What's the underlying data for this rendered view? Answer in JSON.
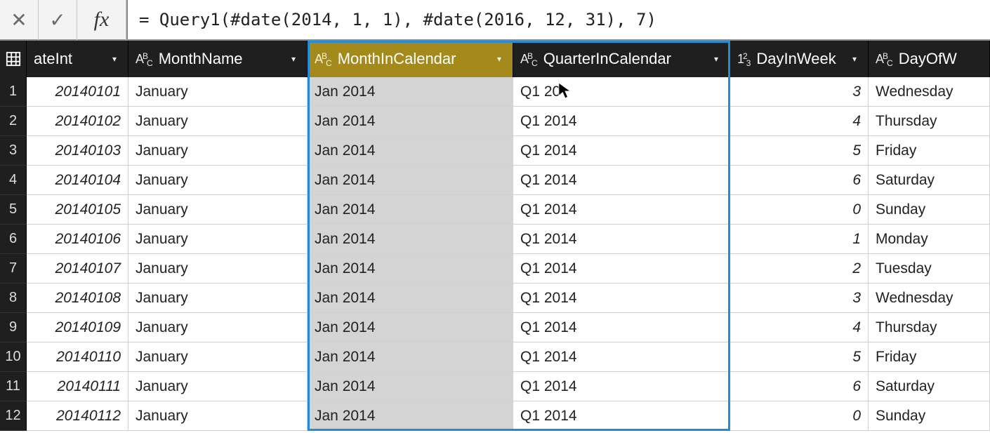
{
  "formula_bar": {
    "cancel_glyph": "✕",
    "confirm_glyph": "✓",
    "fx_label": "fx",
    "formula": "= Query1(#date(2014, 1, 1), #date(2016, 12, 31), 7)"
  },
  "columns": {
    "dateint": {
      "label": "ateInt",
      "type": "num"
    },
    "monthname": {
      "label": "MonthName",
      "type": "text"
    },
    "monthcal": {
      "label": "MonthInCalendar",
      "type": "text"
    },
    "quartcal": {
      "label": "QuarterInCalendar",
      "type": "text"
    },
    "dayinweek": {
      "label": "DayInWeek",
      "type": "num"
    },
    "dayofw": {
      "label": "DayOfW",
      "type": "text"
    }
  },
  "rows": [
    {
      "n": "1",
      "dateint": "20140101",
      "monthname": "January",
      "monthcal": "Jan 2014",
      "quartcal": "Q1 2014",
      "dayinweek": "3",
      "dayofw": "Wednesday"
    },
    {
      "n": "2",
      "dateint": "20140102",
      "monthname": "January",
      "monthcal": "Jan 2014",
      "quartcal": "Q1 2014",
      "dayinweek": "4",
      "dayofw": "Thursday"
    },
    {
      "n": "3",
      "dateint": "20140103",
      "monthname": "January",
      "monthcal": "Jan 2014",
      "quartcal": "Q1 2014",
      "dayinweek": "5",
      "dayofw": "Friday"
    },
    {
      "n": "4",
      "dateint": "20140104",
      "monthname": "January",
      "monthcal": "Jan 2014",
      "quartcal": "Q1 2014",
      "dayinweek": "6",
      "dayofw": "Saturday"
    },
    {
      "n": "5",
      "dateint": "20140105",
      "monthname": "January",
      "monthcal": "Jan 2014",
      "quartcal": "Q1 2014",
      "dayinweek": "0",
      "dayofw": "Sunday"
    },
    {
      "n": "6",
      "dateint": "20140106",
      "monthname": "January",
      "monthcal": "Jan 2014",
      "quartcal": "Q1 2014",
      "dayinweek": "1",
      "dayofw": "Monday"
    },
    {
      "n": "7",
      "dateint": "20140107",
      "monthname": "January",
      "monthcal": "Jan 2014",
      "quartcal": "Q1 2014",
      "dayinweek": "2",
      "dayofw": "Tuesday"
    },
    {
      "n": "8",
      "dateint": "20140108",
      "monthname": "January",
      "monthcal": "Jan 2014",
      "quartcal": "Q1 2014",
      "dayinweek": "3",
      "dayofw": "Wednesday"
    },
    {
      "n": "9",
      "dateint": "20140109",
      "monthname": "January",
      "monthcal": "Jan 2014",
      "quartcal": "Q1 2014",
      "dayinweek": "4",
      "dayofw": "Thursday"
    },
    {
      "n": "10",
      "dateint": "20140110",
      "monthname": "January",
      "monthcal": "Jan 2014",
      "quartcal": "Q1 2014",
      "dayinweek": "5",
      "dayofw": "Friday"
    },
    {
      "n": "11",
      "dateint": "20140111",
      "monthname": "January",
      "monthcal": "Jan 2014",
      "quartcal": "Q1 2014",
      "dayinweek": "6",
      "dayofw": "Saturday"
    },
    {
      "n": "12",
      "dateint": "20140112",
      "monthname": "January",
      "monthcal": "Jan 2014",
      "quartcal": "Q1 2014",
      "dayinweek": "0",
      "dayofw": "Sunday"
    }
  ],
  "cursor_display_quarter": "Q1 20"
}
